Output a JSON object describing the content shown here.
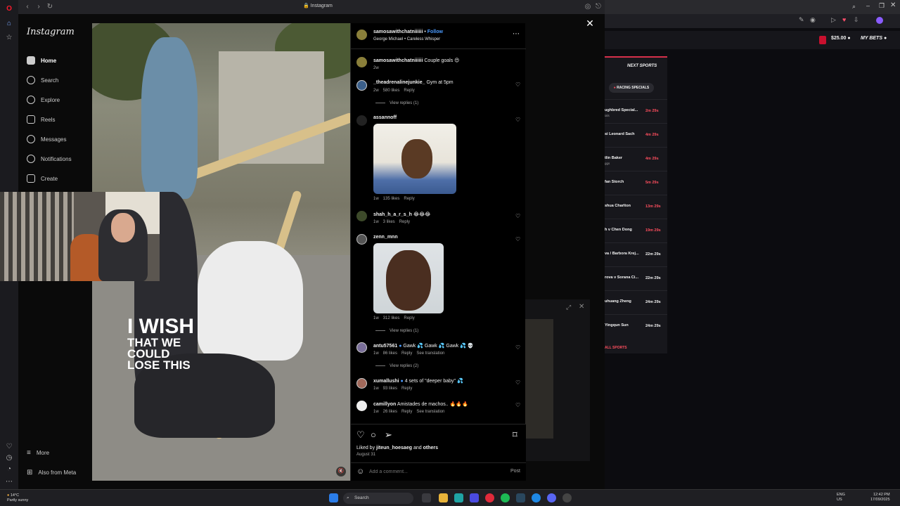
{
  "browser": {
    "url": "Instagram"
  },
  "sidebar": {
    "logo": "Instagram",
    "items": [
      {
        "label": "Home",
        "icon": "home-icon"
      },
      {
        "label": "Search",
        "icon": "search-icon"
      },
      {
        "label": "Explore",
        "icon": "compass-icon"
      },
      {
        "label": "Reels",
        "icon": "reels-icon"
      },
      {
        "label": "Messages",
        "icon": "messenger-icon"
      },
      {
        "label": "Notifications",
        "icon": "heart-icon"
      },
      {
        "label": "Create",
        "icon": "plus-square-icon"
      }
    ],
    "more": "More",
    "also_from_meta": "Also from Meta"
  },
  "video": {
    "caption_line1": "I WISH",
    "caption_line2": "THAT WE",
    "caption_line3": "COULD",
    "caption_line4": "LOSE THIS"
  },
  "post": {
    "author": "samosawithchatniiiiii",
    "follow": "Follow",
    "audio": "George Michael • Careless Whisper",
    "caption_user": "samosawithchatniiiiii",
    "caption_text": "Couple goals 😍",
    "caption_time": "2w",
    "comments": [
      {
        "user": "_theadrenalinejunkie_",
        "text": "Gym at 5pm",
        "time": "2w",
        "likes": "580 likes",
        "reply": "Reply",
        "view_replies": "View replies (1)"
      },
      {
        "user": "assannoff",
        "text": "",
        "time": "1w",
        "likes": "135 likes",
        "reply": "Reply"
      },
      {
        "user": "shah_h_a_r_s_h",
        "text": "😂😂😂",
        "time": "1w",
        "likes": "3 likes",
        "reply": "Reply"
      },
      {
        "user": "zenn_mnn",
        "text": "",
        "time": "1w",
        "likes": "312 likes",
        "reply": "Reply",
        "view_replies": "View replies (1)"
      },
      {
        "user": "antu57561",
        "text": "Gawk 💦 Gawk 💦 Gawk 💦 💀",
        "time": "1w",
        "likes": "86 likes",
        "reply": "Reply",
        "translate": "See translation",
        "view_replies": "View replies (2)"
      },
      {
        "user": "xumallushi",
        "text": "4 sets of \"deeper baby\" 💦",
        "time": "1w",
        "likes": "93 likes",
        "reply": "Reply"
      },
      {
        "user": "camillyon",
        "text": "Amistades de machos.. 🔥🔥🔥",
        "time": "1w",
        "likes": "26 likes",
        "reply": "Reply",
        "translate": "See translation"
      }
    ],
    "liked_by_prefix": "Liked by",
    "liked_by_user": "jiteun_hoesaeg",
    "liked_by_suffix": "and",
    "liked_by_others": "others",
    "date": "August 31",
    "comment_placeholder": "Add a comment...",
    "post_label": "Post"
  },
  "betting": {
    "balance": "$25.00",
    "my_bets": "MY BETS",
    "next_sports": "NEXT SPORTS",
    "racing_specials": "RACING SPECIALS",
    "events": [
      {
        "name": "ughbred Special...",
        "sub": "ials",
        "time": "2m 29s"
      },
      {
        "name": "si Leonard Sach",
        "time": "4m 29s"
      },
      {
        "name": "tlin Baker",
        "sub": "ggs",
        "time": "4m 29s"
      },
      {
        "name": "fan Storch",
        "time": "5m 29s"
      },
      {
        "name": "shua Charlton",
        "time": "13m 29s"
      },
      {
        "name": "h v Chen Dong",
        "time": "19m 29s"
      },
      {
        "name": "va / Barbora Krej...",
        "time": "22m 29s"
      },
      {
        "name": "rova v Sorana Ci...",
        "time": "22m 29s"
      },
      {
        "name": "uhuang Zheng",
        "time": "24m 29s"
      },
      {
        "name": "Yingqun Sun",
        "time": "24m 29s"
      }
    ],
    "all_sports": "ALL SPORTS"
  },
  "taskbar": {
    "weather_temp": "14°C",
    "weather_desc": "Partly sunny",
    "search": "Search",
    "lang1": "ENG",
    "lang2": "US",
    "time": "12:42 PM",
    "date": "17/09/2025"
  }
}
